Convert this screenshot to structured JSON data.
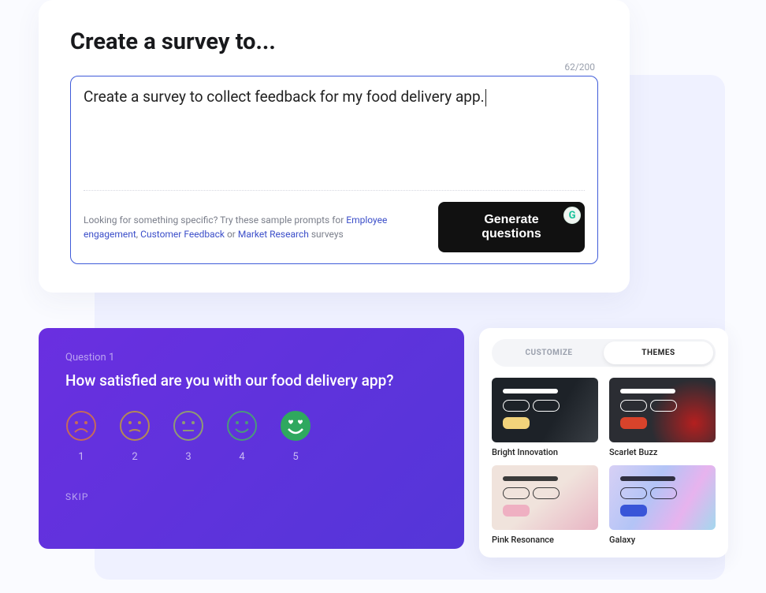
{
  "create": {
    "title": "Create a survey to...",
    "counter": "62/200",
    "prompt_value": "Create a survey to collect feedback for my food delivery app.",
    "hint_prefix": "Looking for something specific? Try these sample prompts for ",
    "link1": "Employee engagement",
    "link2": "Customer Feedback",
    "link3": "Market Research",
    "hint_suffix": " surveys",
    "sep_comma": ", ",
    "sep_or": " or ",
    "generate_label": "Generate questions",
    "grammarly": "G"
  },
  "survey": {
    "question_label": "Question 1",
    "question_text": "How satisfied are you with our food delivery app?",
    "ratings": {
      "r1": "1",
      "r2": "2",
      "r3": "3",
      "r4": "4",
      "r5": "5"
    },
    "skip": "SKIP"
  },
  "themes": {
    "tab_customize": "CUSTOMIZE",
    "tab_themes": "THEMES",
    "items": {
      "t0": "Bright Innovation",
      "t1": "Scarlet Buzz",
      "t2": "Pink Resonance",
      "t3": "Galaxy"
    }
  }
}
